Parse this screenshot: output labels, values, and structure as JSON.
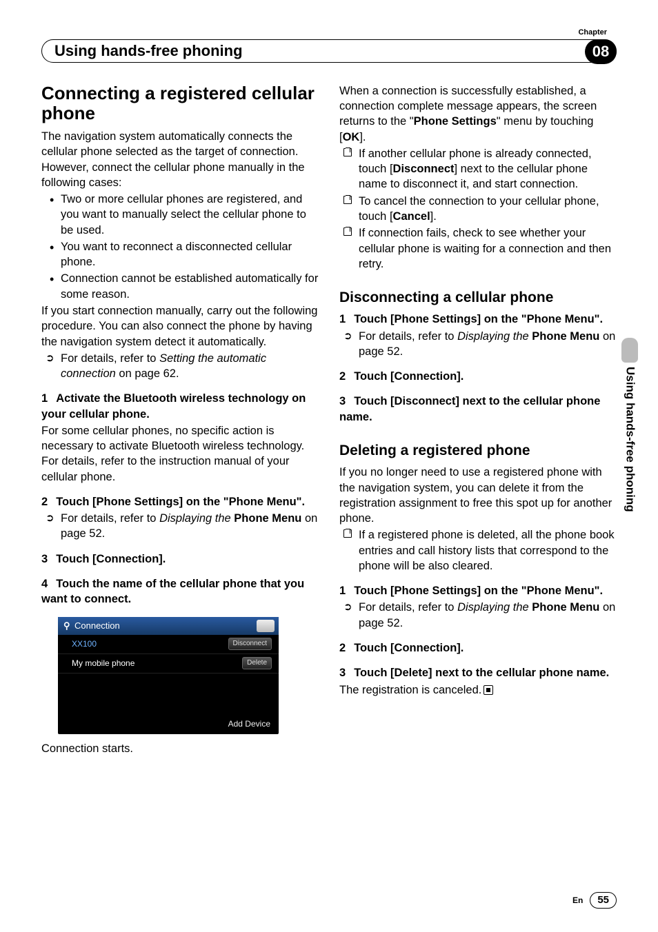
{
  "header": {
    "chapter_label": "Chapter",
    "title": "Using hands-free phoning",
    "chapter_number": "08"
  },
  "side_tab": "Using hands-free phoning",
  "left": {
    "h1": "Connecting a registered cellular phone",
    "intro": "The navigation system automatically connects the cellular phone selected as the target of connection. However, connect the cellular phone manually in the following cases:",
    "bullets": [
      "Two or more cellular phones are registered, and you want to manually select the cellular phone to be used.",
      "You want to reconnect a disconnected cellular phone.",
      "Connection cannot be established automatically for some reason."
    ],
    "after_bullets": "If you start connection manually, carry out the following procedure. You can also connect the phone by having the navigation system detect it automatically.",
    "ref1_a": "For details, refer to ",
    "ref1_b": "Setting the automatic connection",
    "ref1_c": " on page 62.",
    "step1": "Activate the Bluetooth wireless technology on your cellular phone.",
    "step1_body": "For some cellular phones, no specific action is necessary to activate Bluetooth wireless technology. For details, refer to the instruction manual of your cellular phone.",
    "step2": "Touch [Phone Settings] on the \"Phone Menu\".",
    "ref2_a": "For details, refer to ",
    "ref2_b": "Displaying the",
    "ref2_c": "Phone Menu",
    "ref2_d": " on page 52.",
    "step3": "Touch [Connection].",
    "step4": "Touch the name of the cellular phone that you want to connect.",
    "screenshot": {
      "title": "Connection",
      "row1_name": "XX100",
      "row1_btn": "Disconnect",
      "row2_name": "My mobile phone",
      "row2_btn": "Delete",
      "footer": "Add Device"
    },
    "conn_starts": "Connection starts."
  },
  "right": {
    "top_para_a": "When a connection is successfully established, a connection complete message appears, the screen returns to the \"",
    "top_para_b": "Phone Settings",
    "top_para_c": "\" menu by touching [",
    "top_para_d": "OK",
    "top_para_e": "].",
    "notes": [
      {
        "a": "If another cellular phone is already connected, touch [",
        "b": "Disconnect",
        "c": "] next to the cellular phone name to disconnect it, and start connection."
      },
      {
        "a": "To cancel the connection to your cellular phone, touch [",
        "b": "Cancel",
        "c": "]."
      },
      {
        "a": "If connection fails, check to see whether your cellular phone is waiting for a connection and then retry.",
        "b": "",
        "c": ""
      }
    ],
    "disc_h": "Disconnecting a cellular phone",
    "disc_s1": "Touch [Phone Settings] on the \"Phone Menu\".",
    "disc_ref_a": "For details, refer to ",
    "disc_ref_b": "Displaying the",
    "disc_ref_c": "Phone Menu",
    "disc_ref_d": " on page 52.",
    "disc_s2": "Touch [Connection].",
    "disc_s3": "Touch [Disconnect] next to the cellular phone name.",
    "del_h": "Deleting a registered phone",
    "del_intro": "If you no longer need to use a registered phone with the navigation system, you can delete it from the registration assignment to free this spot up for another phone.",
    "del_note": "If a registered phone is deleted, all the phone book entries and call history lists that correspond to the phone will be also cleared.",
    "del_s1": "Touch [Phone Settings] on the \"Phone Menu\".",
    "del_ref_a": "For details, refer to ",
    "del_ref_b": "Displaying the",
    "del_ref_c": "Phone Menu",
    "del_ref_d": " on page 52.",
    "del_s2": "Touch [Connection].",
    "del_s3": "Touch [Delete] next to the cellular phone name.",
    "del_body": "The registration is canceled."
  },
  "footer": {
    "lang": "En",
    "page": "55"
  }
}
